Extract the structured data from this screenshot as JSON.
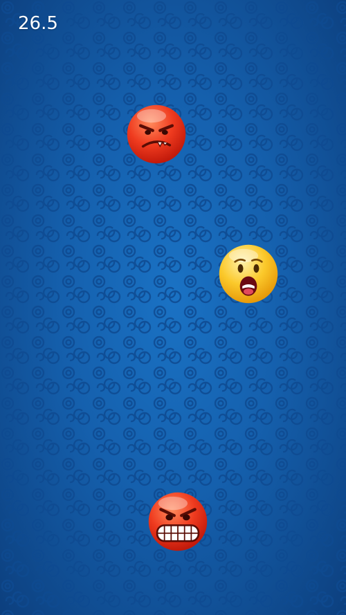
{
  "hud": {
    "timer": "26.5"
  },
  "emojis": [
    {
      "icon": "angry-red-emoji-icon",
      "color": "#e8361e"
    },
    {
      "icon": "shocked-yellow-emoji-icon",
      "color": "#f7b818"
    },
    {
      "icon": "grimace-red-emoji-icon",
      "color": "#e8361e"
    }
  ],
  "colors": {
    "background": "#1566b5",
    "pattern": "#0d4a90",
    "timer_text": "#ffffff"
  }
}
